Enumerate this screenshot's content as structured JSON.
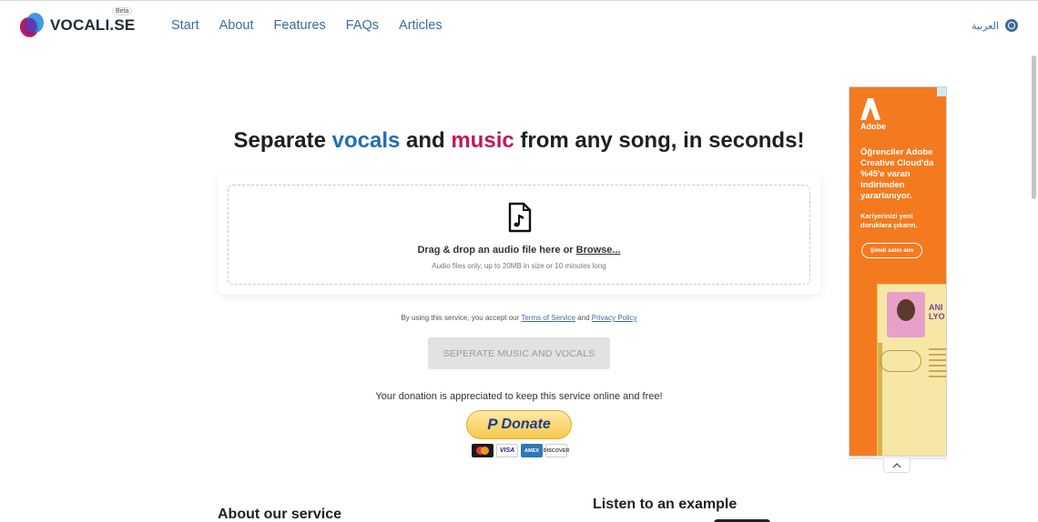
{
  "header": {
    "logo_text": "VOCALI.SE",
    "beta_label": "Beta",
    "nav": [
      {
        "label": "Start"
      },
      {
        "label": "About"
      },
      {
        "label": "Features"
      },
      {
        "label": "FAQs"
      },
      {
        "label": "Articles"
      }
    ],
    "language_label": "العربية",
    "language_icon": "globe-icon"
  },
  "hero": {
    "headline_pre": "Separate ",
    "headline_vocals": "vocals",
    "headline_mid": " and ",
    "headline_music": "music",
    "headline_post": " from any song, in seconds!",
    "vocals_color": "#1f6fb5",
    "music_color": "#c2185b"
  },
  "upload": {
    "icon": "music-file-icon",
    "title_pre": "Drag & drop an audio file here or ",
    "browse_label": "Browse...",
    "subtitle": "Audio files only, up to 20MB in size or 10 minutes long"
  },
  "terms": {
    "pre": "By using this service, you accept our ",
    "tos_label": "Terms of Service",
    "mid": " and ",
    "privacy_label": "Privacy Policy"
  },
  "separate_button": {
    "label": "SEPERATE MUSIC AND VOCALS",
    "disabled": true
  },
  "donation": {
    "text": "Your donation is appreciated to keep this service online and free!",
    "paypal_p": "P",
    "button_label": "Donate",
    "cards": [
      "MC",
      "VISA",
      "AMEX",
      "DISCOVER"
    ]
  },
  "sections": {
    "about_heading": "About our service",
    "listen_heading": "Listen to an example"
  },
  "ad": {
    "brand": "Adobe",
    "headline": "Öğrenciler Adobe Creative Cloud'da %45'e varan indirimden yararlanıyor.",
    "subline": "Kariyerinizi yeni doruklara çıkarın.",
    "cta": "Şimdi satın alın",
    "mock_name": "ANI LYO",
    "color": "#f47a1f"
  }
}
